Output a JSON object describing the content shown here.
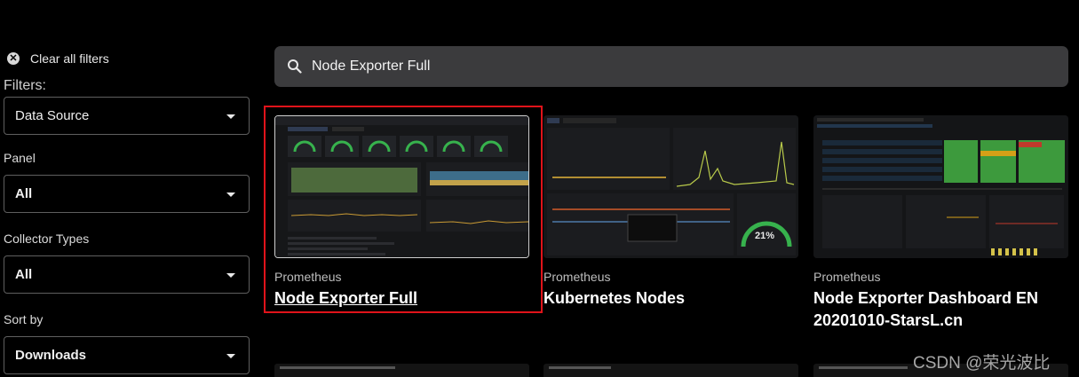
{
  "sidebar": {
    "clear_filters_label": "Clear all filters",
    "filters_title": "Filters:",
    "data_source": {
      "label": "",
      "value": "Data Source"
    },
    "panel": {
      "label": "Panel",
      "value": "All"
    },
    "collector_types": {
      "label": "Collector Types",
      "value": "All"
    },
    "sort_by": {
      "label": "Sort by",
      "value": "Downloads"
    }
  },
  "search": {
    "value": "Node Exporter Full"
  },
  "cards": [
    {
      "source": "Prometheus",
      "title": "Node Exporter Full",
      "selected": true
    },
    {
      "source": "Prometheus",
      "title": "Kubernetes Nodes",
      "gauge_value": "21%"
    },
    {
      "source": "Prometheus",
      "title": "Node Exporter Dashboard EN 20201010-StarsL.cn"
    }
  ],
  "watermark": "CSDN @荣光波比",
  "colors": {
    "highlight": "#e0131a",
    "gauge_green": "#37b24d",
    "search_bg": "#3b3b3d"
  }
}
